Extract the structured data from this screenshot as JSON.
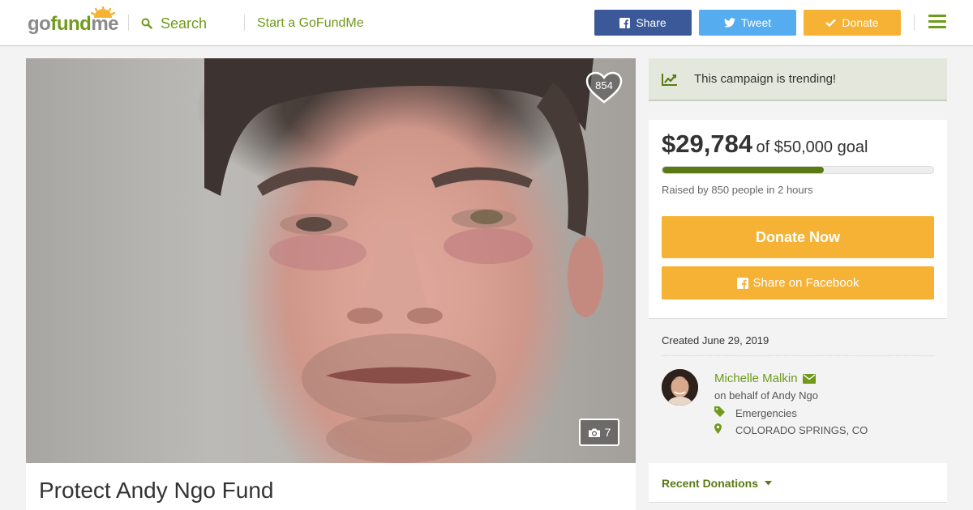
{
  "header": {
    "logo": "gofundme",
    "search_label": "Search",
    "start_label": "Start a GoFundMe",
    "share_label": "Share",
    "tweet_label": "Tweet",
    "donate_label": "Donate",
    "colors": {
      "brand_green": "#6f9a1a",
      "facebook": "#3b5998",
      "twitter": "#55acee",
      "donate": "#f6b234"
    }
  },
  "photo": {
    "heart_count": "854",
    "photo_count": "7"
  },
  "campaign": {
    "title": "Protect Andy Ngo Fund"
  },
  "trending": {
    "text": "This campaign is trending!"
  },
  "progress": {
    "raised": "$29,784",
    "goal_text": "of $50,000 goal",
    "progress_fraction": 0.5957,
    "raised_by": "Raised by 850 people in 2 hours",
    "donate_now_label": "Donate Now",
    "share_facebook_label": "Share on Facebook"
  },
  "organizer": {
    "created": "Created June 29, 2019",
    "name": "Michelle Malkin",
    "on_behalf": "on behalf of Andy Ngo",
    "category": "Emergencies",
    "location": "COLORADO SPRINGS, CO"
  },
  "recent": {
    "label": "Recent Donations"
  }
}
